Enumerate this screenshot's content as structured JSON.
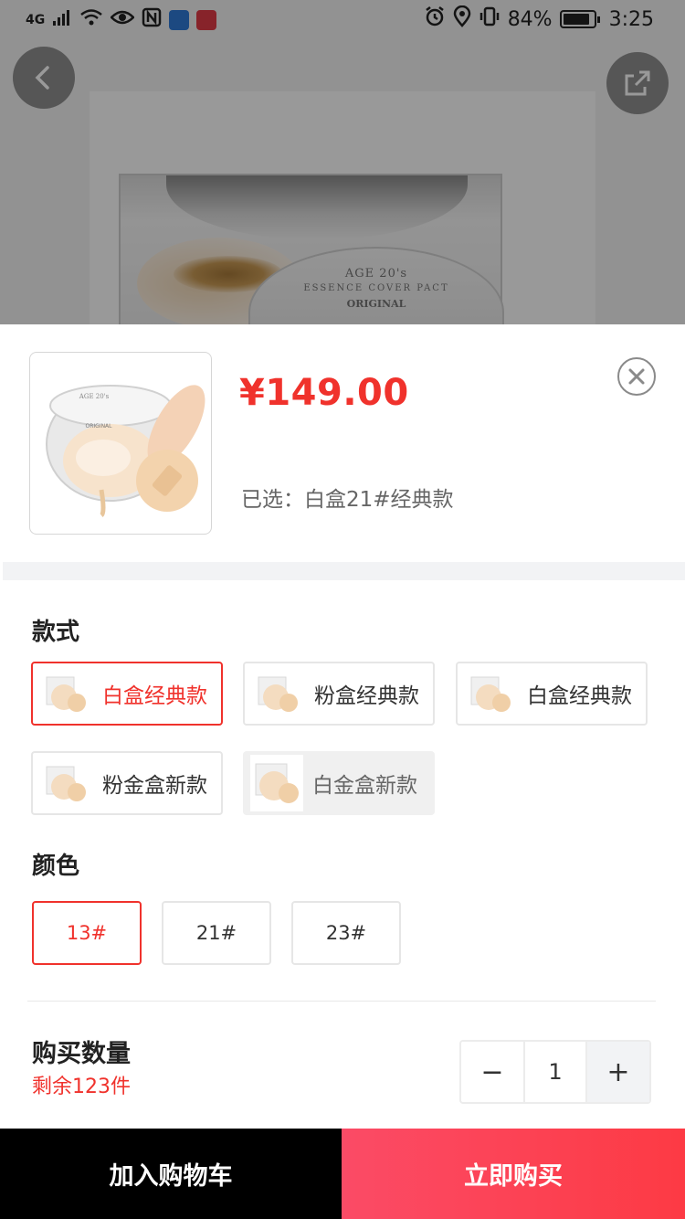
{
  "status_bar": {
    "network": "4G",
    "battery": "84%",
    "time": "3:25"
  },
  "background_product": {
    "brand_line1": "AGE 20's",
    "brand_line2": "ESSENCE COVER PACT",
    "brand_line3": "ORIGINAL"
  },
  "sheet": {
    "price": "¥149.00",
    "selected_text": "已选：白盒21#经典款",
    "style_title": "款式",
    "styles": [
      {
        "label": "白盒经典款",
        "state": "selected"
      },
      {
        "label": "粉盒经典款",
        "state": "normal"
      },
      {
        "label": "白盒经典款",
        "state": "normal"
      },
      {
        "label": "粉金盒新款",
        "state": "normal"
      },
      {
        "label": "白金盒新款",
        "state": "disabled"
      }
    ],
    "color_title": "颜色",
    "colors": [
      {
        "label": "13#",
        "state": "selected"
      },
      {
        "label": "21#",
        "state": "normal"
      },
      {
        "label": "23#",
        "state": "normal"
      }
    ],
    "quantity_title": "购买数量",
    "stock_text": "剩余123件",
    "quantity": {
      "minus": "−",
      "value": "1",
      "plus": "+"
    }
  },
  "actions": {
    "add_to_cart": "加入购物车",
    "buy_now": "立即购买"
  },
  "colors": {
    "accent_red": "#f0322c",
    "buy_gradient_start": "#fb4b66",
    "buy_gradient_end": "#fd3a44",
    "cart_bg": "#000000"
  },
  "icons": [
    "back-arrow-icon",
    "share-icon",
    "close-circle-icon",
    "minus-icon",
    "plus-icon",
    "alarm-icon",
    "location-icon",
    "vibrate-icon",
    "wifi-icon",
    "eye-icon",
    "nfc-icon",
    "signal-icon"
  ]
}
